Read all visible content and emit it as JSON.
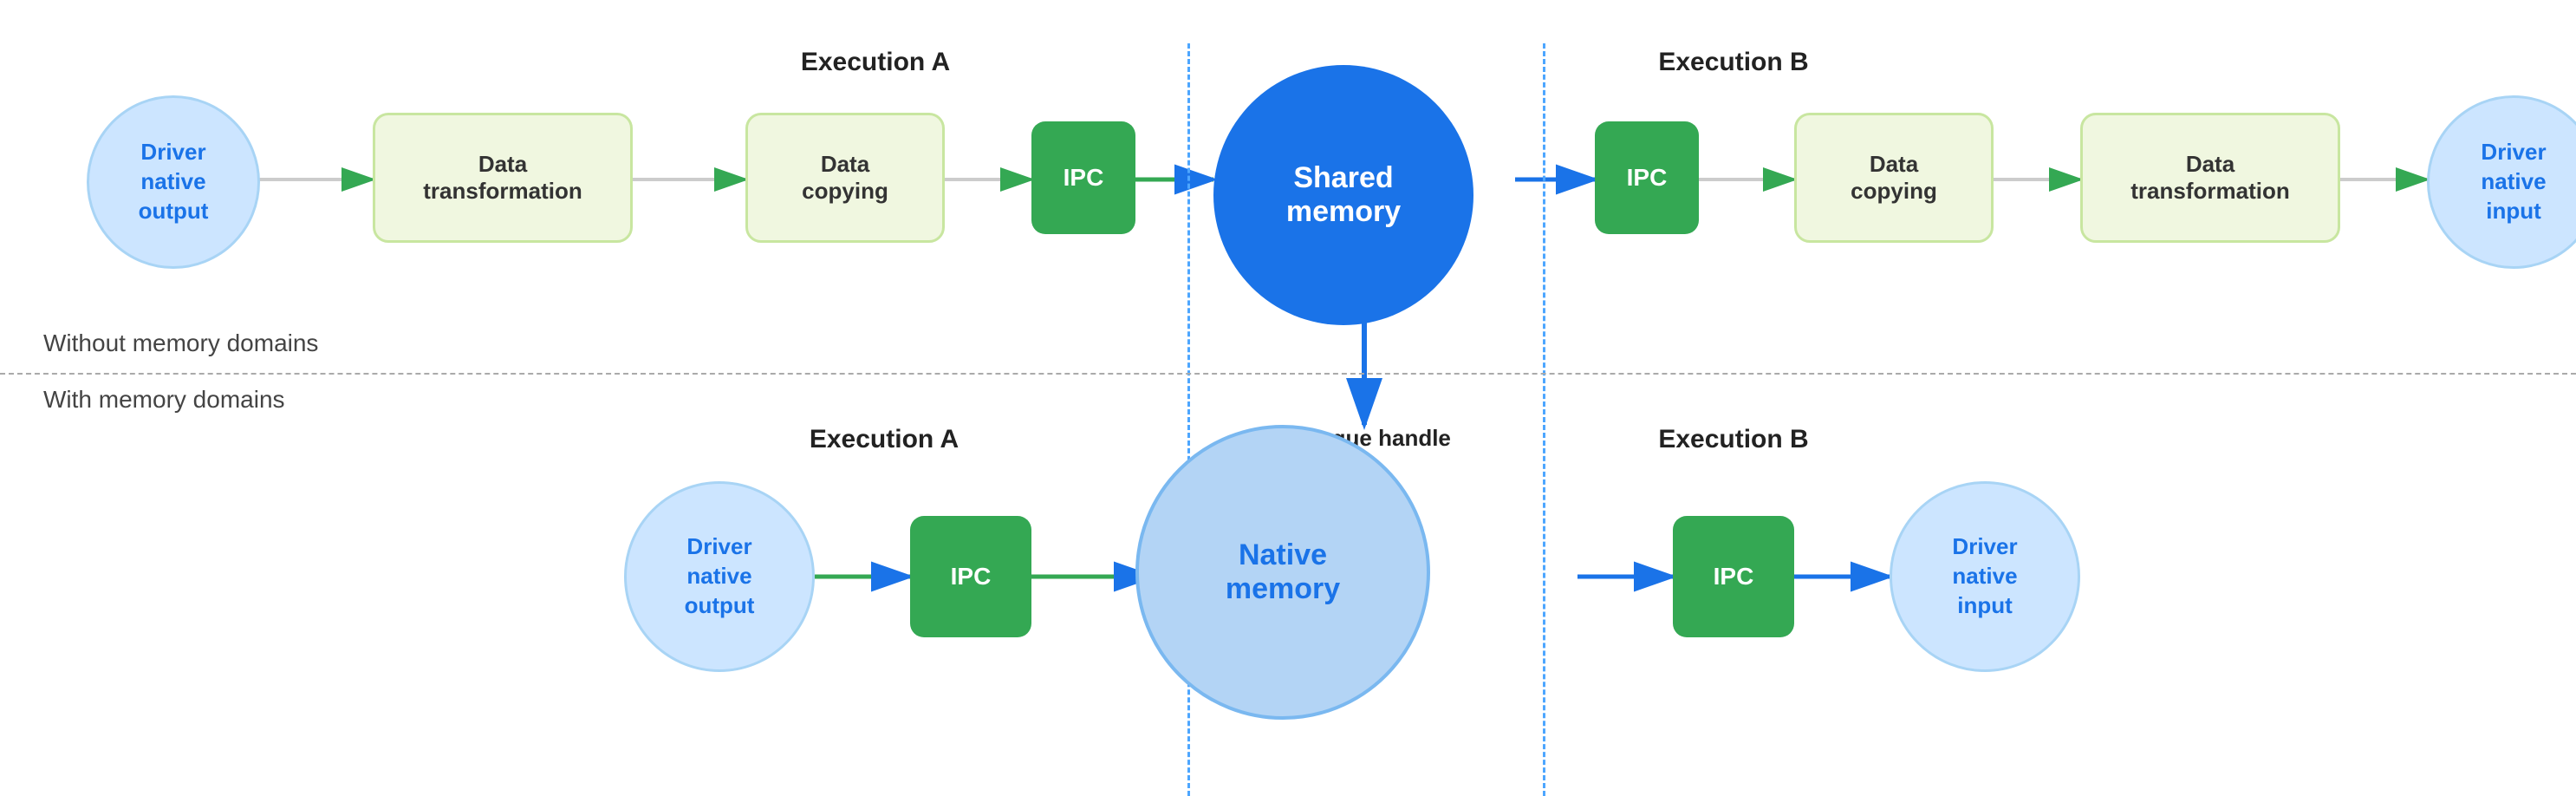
{
  "sections": {
    "without_label": "Without memory domains",
    "with_label": "With memory domains"
  },
  "top_row": {
    "exec_a_label": "Execution A",
    "exec_b_label": "Execution B",
    "nodes": [
      {
        "id": "driver-out-top",
        "label": "Driver\nnative\noutput",
        "type": "circle",
        "color": "light-blue"
      },
      {
        "id": "data-transform-1",
        "label": "Data\ntransformation",
        "type": "rect",
        "color": "light-green"
      },
      {
        "id": "data-copy-1",
        "label": "Data\ncopying",
        "type": "rect",
        "color": "light-green"
      },
      {
        "id": "ipc-1",
        "label": "IPC",
        "type": "rect",
        "color": "green"
      },
      {
        "id": "shared-memory",
        "label": "Shared\nmemory",
        "type": "circle",
        "color": "blue-large"
      },
      {
        "id": "ipc-2",
        "label": "IPC",
        "type": "rect",
        "color": "green"
      },
      {
        "id": "data-copy-2",
        "label": "Data\ncopying",
        "type": "rect",
        "color": "light-green"
      },
      {
        "id": "data-transform-2",
        "label": "Data\ntransformation",
        "type": "rect",
        "color": "light-green"
      },
      {
        "id": "driver-in-top",
        "label": "Driver\nnative\ninput",
        "type": "circle",
        "color": "light-blue"
      }
    ]
  },
  "bottom_row": {
    "exec_a_label": "Execution A",
    "exec_b_label": "Execution B",
    "opaque_label": "Opaque handle",
    "nodes": [
      {
        "id": "driver-out-bottom",
        "label": "Driver\nnative\noutput",
        "type": "circle",
        "color": "light-blue"
      },
      {
        "id": "ipc-3",
        "label": "IPC",
        "type": "rect",
        "color": "green"
      },
      {
        "id": "native-memory",
        "label": "Native\nmemory",
        "type": "circle",
        "color": "native-memory"
      },
      {
        "id": "ipc-4",
        "label": "IPC",
        "type": "rect",
        "color": "green"
      },
      {
        "id": "driver-in-bottom",
        "label": "Driver\nnative\ninput",
        "type": "circle",
        "color": "light-blue"
      }
    ]
  }
}
